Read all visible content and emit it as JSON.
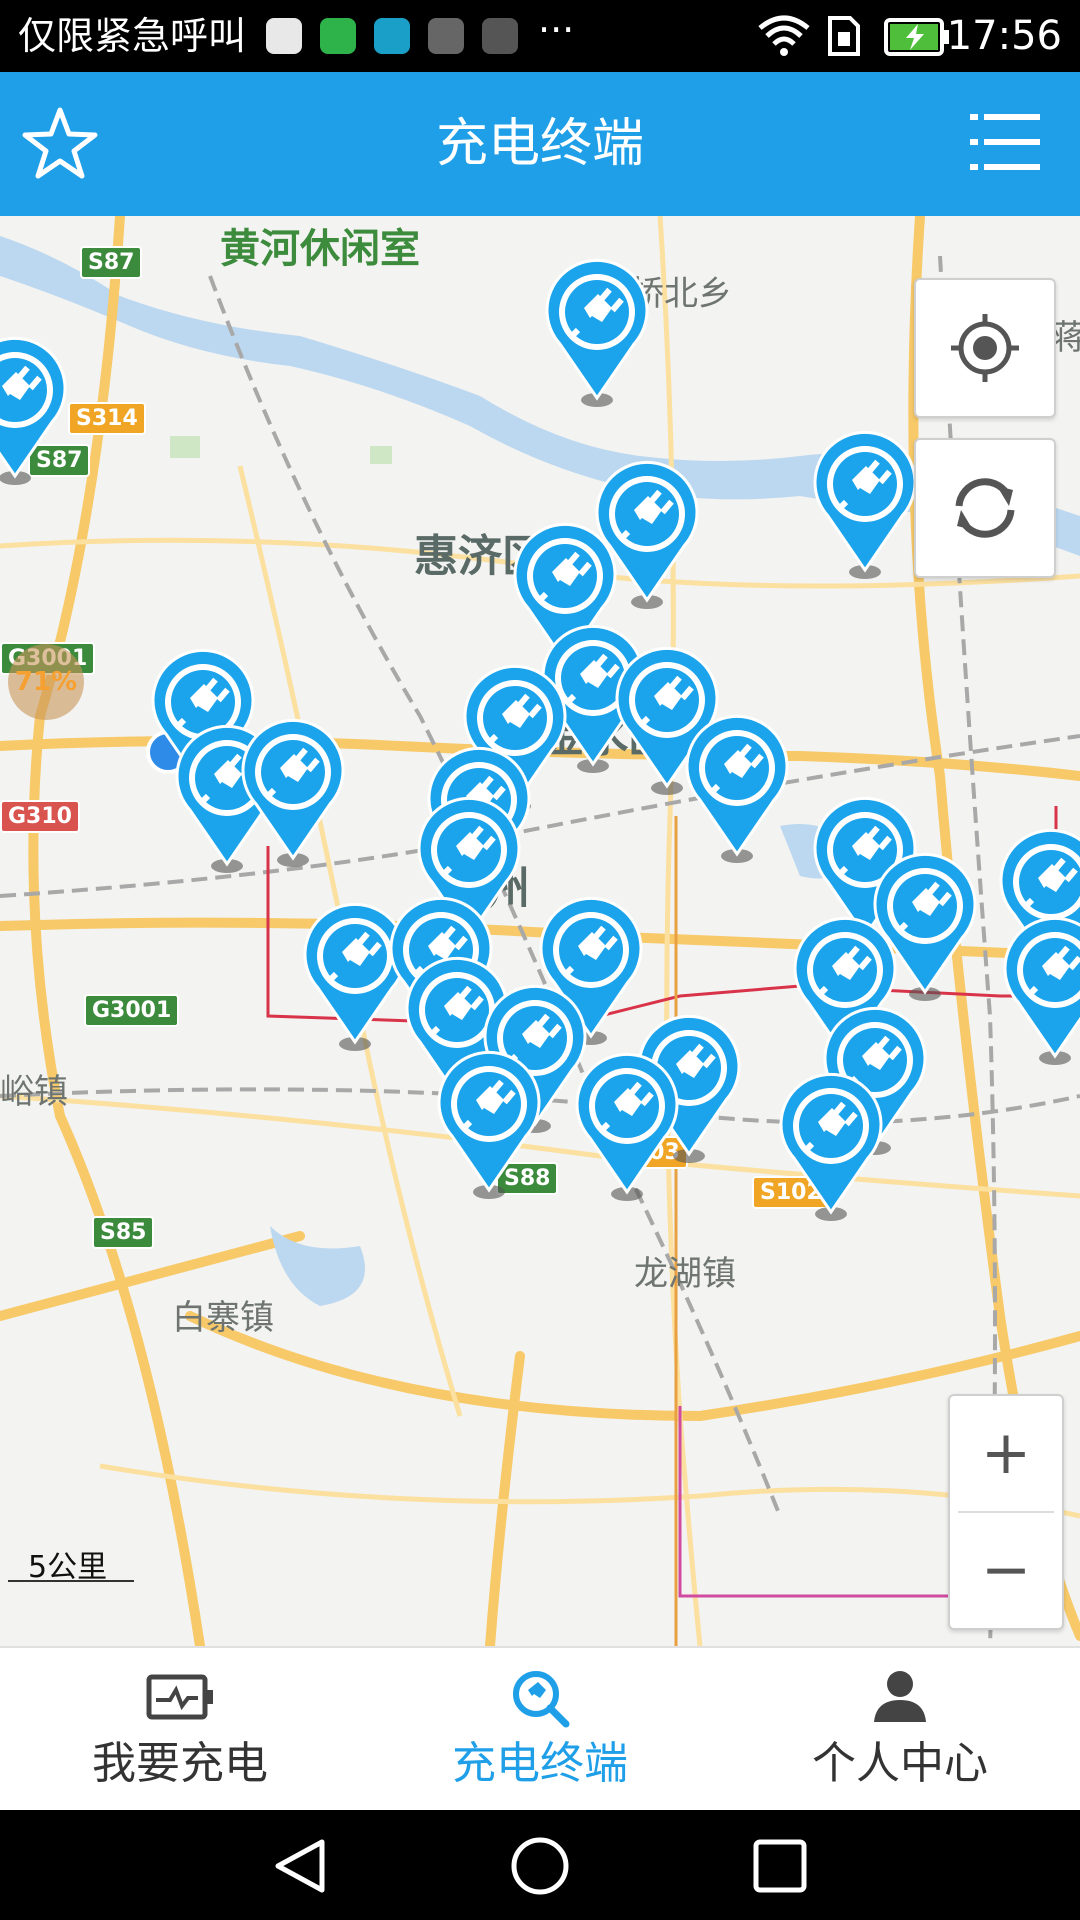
{
  "status_bar": {
    "carrier": "仅限紧急呼叫",
    "dots": "···",
    "time": "17:56"
  },
  "header": {
    "title": "充电终端",
    "favorite_icon": "star-outline-icon",
    "menu_icon": "list-menu-icon"
  },
  "map": {
    "places": {
      "huanghe": "黄河休闲室",
      "qiaobei": "桥北乡",
      "huiji": "惠济区",
      "jinshui": "金水区",
      "zhou": "州",
      "qu": "区",
      "yuzhen": "峪镇",
      "longhu": "龙湖镇",
      "baizhai": "白寨镇",
      "cang": "蒋"
    },
    "roads": {
      "s87_top": "S87",
      "s314": "S314",
      "s87_mid": "S87",
      "g3001_left": "G3001",
      "g310": "G310",
      "g3001_bottom": "G3001",
      "s85": "S85",
      "s88": "S88",
      "s103": "S103",
      "s102": "S102"
    },
    "cluster_label": "71%",
    "scale": "5公里",
    "locate_icon": "crosshair-icon",
    "refresh_icon": "refresh-icon",
    "zoom_in": "+",
    "zoom_out": "−"
  },
  "bottom_nav": {
    "items": [
      {
        "label": "我要充电",
        "icon": "charging-monitor-icon",
        "active": false
      },
      {
        "label": "充电终端",
        "icon": "charger-search-icon",
        "active": true
      },
      {
        "label": "个人中心",
        "icon": "person-icon",
        "active": false
      }
    ]
  },
  "colors": {
    "accent": "#1e9fe8",
    "pin": "#1ba4ec",
    "inactive_text": "#333333"
  }
}
